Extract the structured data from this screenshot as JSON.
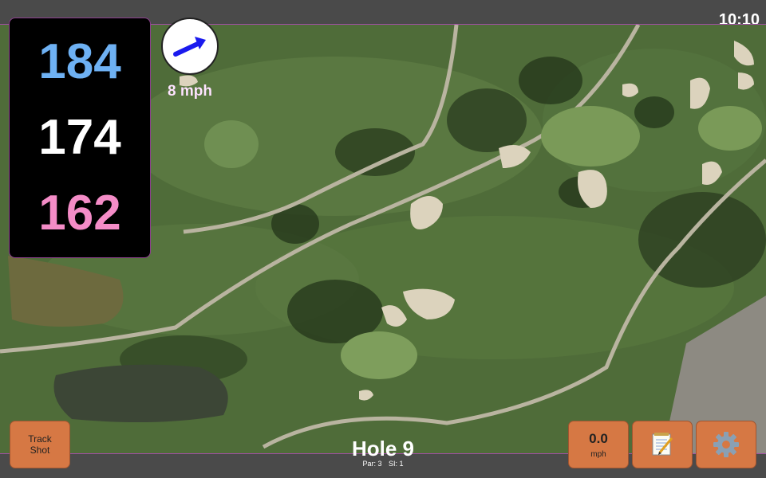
{
  "status": {
    "time": "10:10"
  },
  "distances": {
    "back": "184",
    "middle": "174",
    "front": "162"
  },
  "wind": {
    "speed_label": "8 mph",
    "arrow_icon": "wind-direction-arrow-icon",
    "arrow_color": "#1a1aee"
  },
  "hole": {
    "title": "Hole 9",
    "par": "Par: 3",
    "si": "SI: 1"
  },
  "buttons": {
    "track_shot": "Track\nShot",
    "speed_value": "0.0",
    "speed_unit": "mph",
    "notes_icon": "notepad-icon",
    "settings_icon": "gear-icon"
  },
  "colors": {
    "button": "#d67844",
    "back_distance": "#6eb1f3",
    "middle_distance": "#ffffff",
    "front_distance": "#f48cc7",
    "accent_border": "#a24fa5"
  }
}
